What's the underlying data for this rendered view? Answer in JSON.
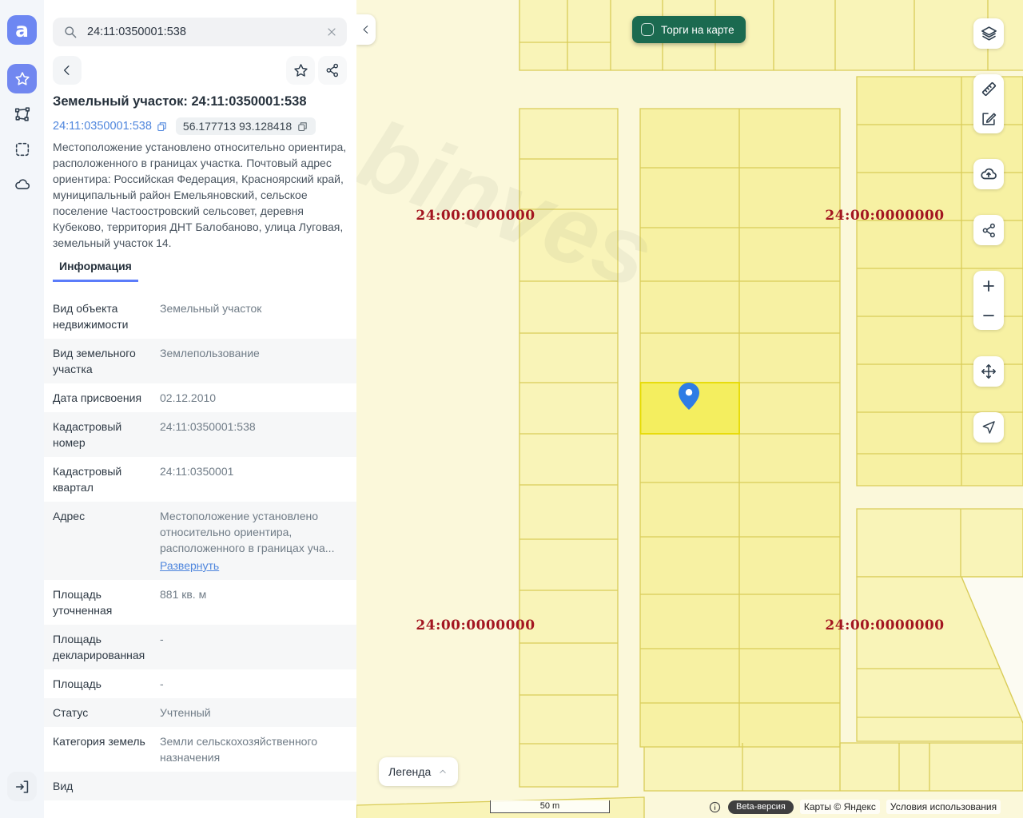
{
  "app": {
    "logo_letter": "a"
  },
  "search": {
    "value": "24:11:0350001:538"
  },
  "panel": {
    "title": "Земельный участок: 24:11:0350001:538",
    "cadastral_chip": "24:11:0350001:538",
    "coords_chip": "56.177713 93.128418",
    "description": "Местоположение установлено относительно ориентира, расположенного в границах участка. Почтовый адрес ориентира: Российская Федерация, Красноярский край, муниципальный район Емельяновский, сельское поселение Частоостровский сельсовет, деревня Кубеково, территория ДНТ Балобаново, улица Луговая, земельный участок 14.",
    "tab": "Информация",
    "info_rows": [
      {
        "label": "Вид объекта недвижимости",
        "value": "Земельный участок"
      },
      {
        "label": "Вид земельного участка",
        "value": "Землепользование"
      },
      {
        "label": "Дата присвоения",
        "value": "02.12.2010"
      },
      {
        "label": "Кадастровый номер",
        "value": "24:11:0350001:538"
      },
      {
        "label": "Кадастровый квартал",
        "value": "24:11:0350001"
      },
      {
        "label": "Адрес",
        "value": "Местоположение установлено относительно ориентира, расположенного в границах уча...",
        "link": "Развернуть"
      },
      {
        "label": "Площадь уточненная",
        "value": "881 кв. м"
      },
      {
        "label": "Площадь декларированная",
        "value": "-"
      },
      {
        "label": "Площадь",
        "value": "-"
      },
      {
        "label": "Статус",
        "value": "Учтенный"
      },
      {
        "label": "Категория земель",
        "value": "Земли сельскохозяйственного назначения"
      },
      {
        "label": "Вид",
        "value": ""
      }
    ]
  },
  "map": {
    "toggle_label": "Торги на карте",
    "district_label": "24:00:0000000",
    "legend_label": "Легенда",
    "scale_label": "50 m",
    "watermark": "binves",
    "attribution": {
      "beta": "Beta-версия",
      "maps": "Карты © Яндекс",
      "terms": "Условия использования"
    },
    "colors": {
      "accent_blue": "#6d87f2",
      "link_blue": "#4f86dd",
      "district_red": "#a31621",
      "toggle_green": "#1b6a50",
      "parcel_fill": "#f8f3ad",
      "parcel_border": "#d9cc58",
      "selected_parcel": "#f4ee5f",
      "pin_blue": "#2e7ce5"
    }
  }
}
